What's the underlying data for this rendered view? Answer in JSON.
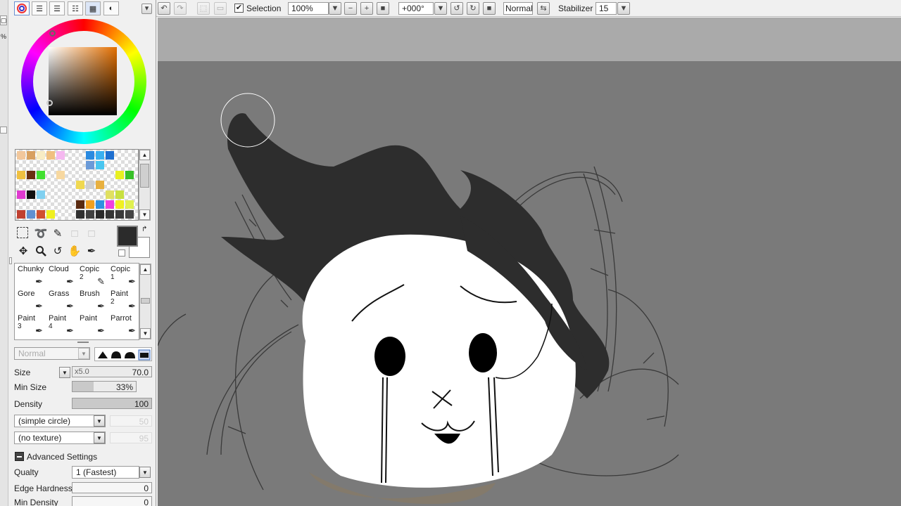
{
  "toolbar": {
    "selection_label": "Selection",
    "selection_checked": true,
    "zoom_value": "100%",
    "rotation_value": "+000°",
    "blend_mode": "Normal",
    "stabilizer_label": "Stabilizer",
    "stabilizer_value": "15"
  },
  "edge": {
    "zoom_percent": "%"
  },
  "brushes": [
    {
      "label": "Chunky",
      "sub": ""
    },
    {
      "label": "Cloud",
      "sub": ""
    },
    {
      "label": "Copic",
      "sub": "2"
    },
    {
      "label": "Copic",
      "sub": "1"
    },
    {
      "label": "Gore",
      "sub": ""
    },
    {
      "label": "Grass",
      "sub": ""
    },
    {
      "label": "Brush",
      "sub": ""
    },
    {
      "label": "Paint",
      "sub": "2"
    },
    {
      "label": "Paint",
      "sub": "3"
    },
    {
      "label": "Paint",
      "sub": "4"
    },
    {
      "label": "Paint",
      "sub": ""
    },
    {
      "label": "Parrot",
      "sub": ""
    }
  ],
  "brush_settings": {
    "blend_mode": "Normal",
    "size_label": "Size",
    "size_multiplier": "x5.0",
    "size_value": "70.0",
    "min_size_label": "Min Size",
    "min_size_value": "33%",
    "min_size_fraction": 0.33,
    "density_label": "Density",
    "density_value": "100",
    "density_fraction": 1.0,
    "shape_select": "(simple circle)",
    "shape_strength": "50",
    "texture_select": "(no texture)",
    "texture_strength": "95",
    "advanced_label": "Advanced Settings",
    "quality_label": "Qualty",
    "quality_value": "1 (Fastest)",
    "edge_hardness_label": "Edge Hardness",
    "edge_hardness_value": "0",
    "min_density_label": "Min Density",
    "min_density_value": "0"
  },
  "colors": {
    "primary": "#2b2b2b",
    "secondary": "#ffffff",
    "canvas_bg": "#7a7a7a",
    "workspace_bg": "#aaaaaa"
  }
}
